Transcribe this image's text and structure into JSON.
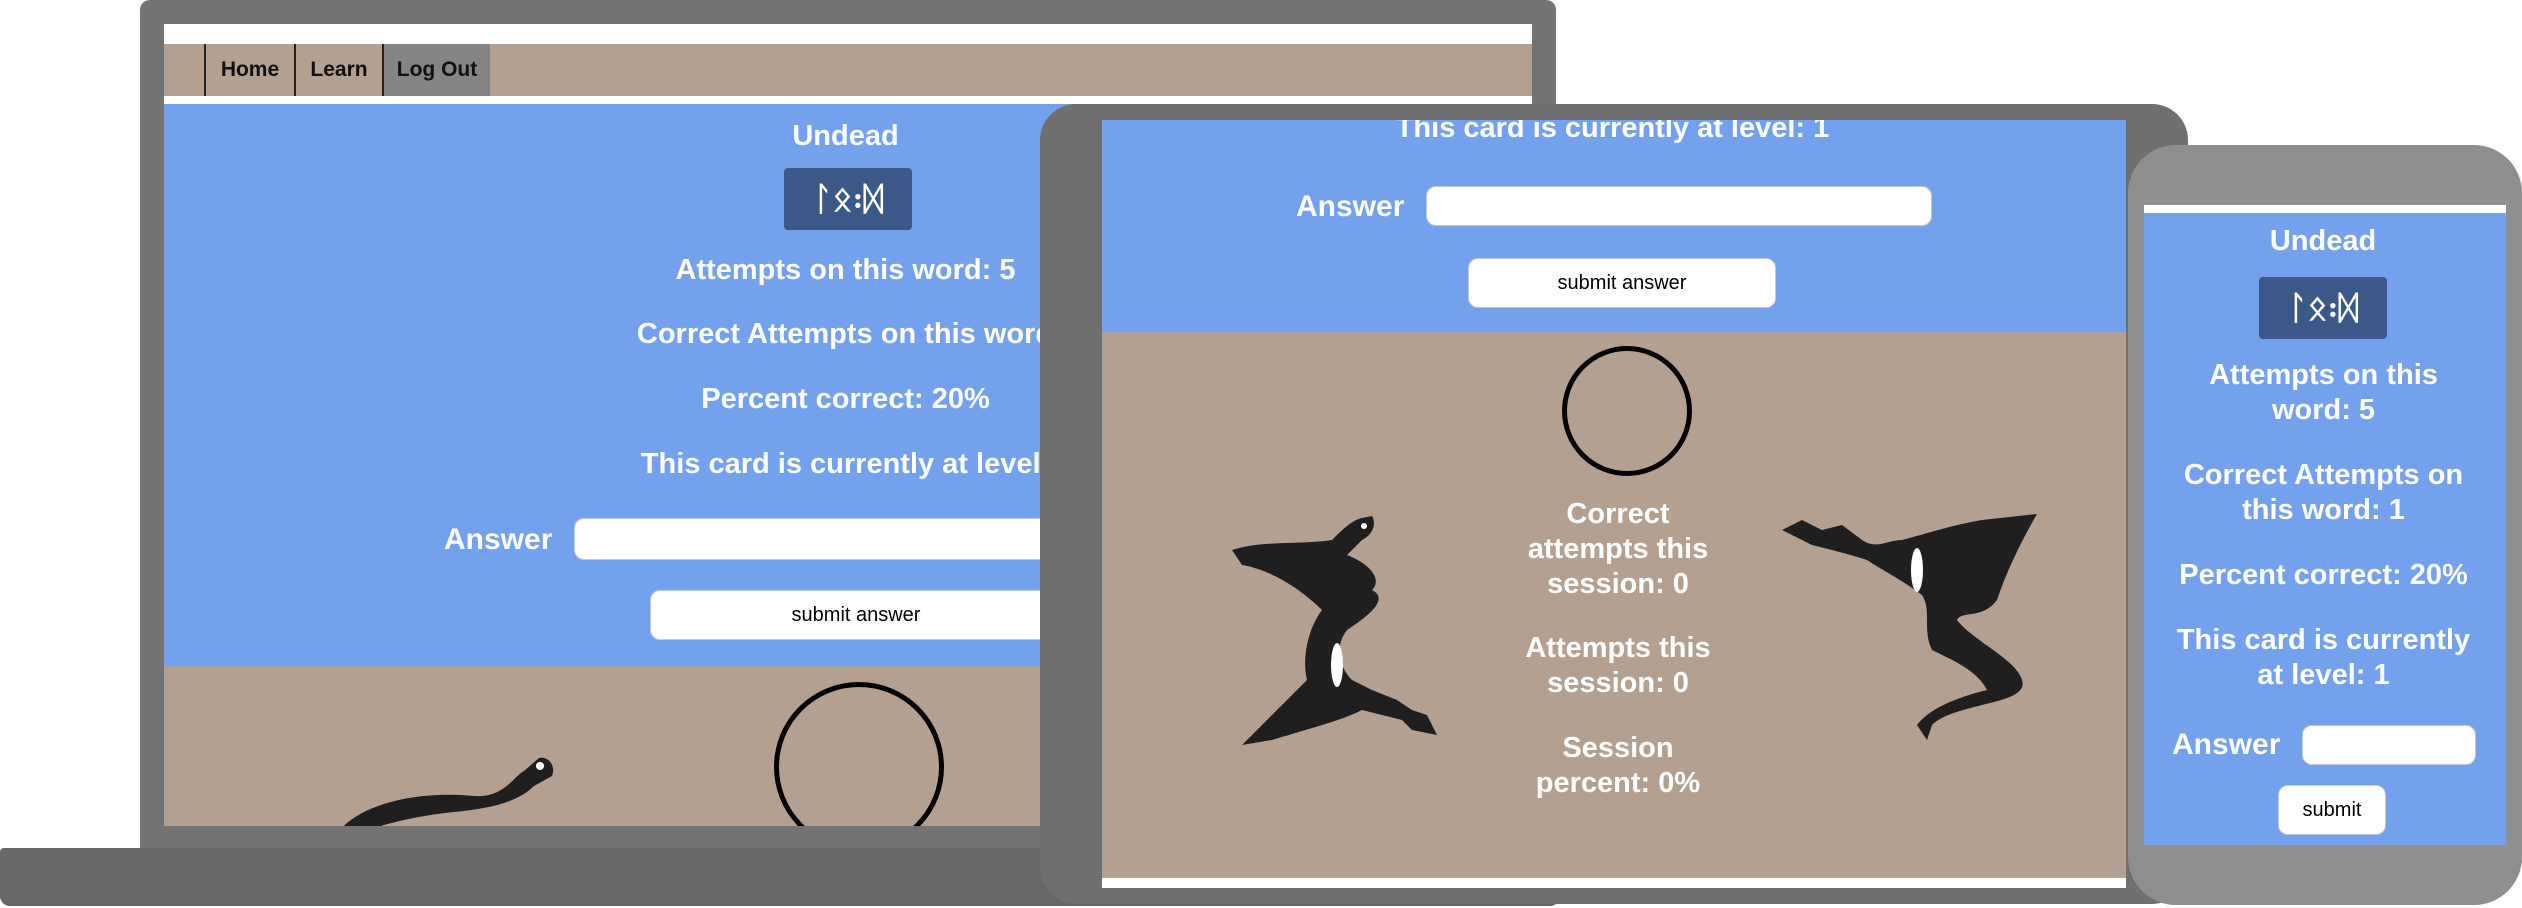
{
  "nav": {
    "home": "Home",
    "learn": "Learn",
    "logout": "Log Out"
  },
  "card": {
    "word": "Undead",
    "glyph": "ᛚᛟ꞉ᛞ",
    "attempts": "Attempts on this word: 5",
    "attempts_line1": "Attempts on this",
    "attempts_line2": "word: 5",
    "correct_attempts_cut": "Correct Attempts on this word",
    "correct_line1": "Correct Attempts on",
    "correct_line2": "this word: 1",
    "percent": "Percent correct: 20%",
    "level_cut": "This card is currently at level:",
    "level": "This card is currently at level: 1",
    "level_line1": "This card is currently",
    "level_line2": "at level: 1"
  },
  "form": {
    "answer_label": "Answer",
    "submit_label": "submit answer",
    "submit_short": "submit"
  },
  "session": {
    "correct_l1": "Correct",
    "correct_l2": "attempts this",
    "correct_l3": "session: 0",
    "attempts_l1": "Attempts this",
    "attempts_l2": "session: 0",
    "percent_l1": "Session",
    "percent_l2": "percent: 0%"
  },
  "colors": {
    "blue_panel": "#74a1ee",
    "tan_panel": "#b3a091",
    "glyph_box": "#3a5888",
    "bezel": "#6f6f6f"
  },
  "icons": {
    "dragon": "dragon-icon",
    "circle": "progress-circle"
  }
}
